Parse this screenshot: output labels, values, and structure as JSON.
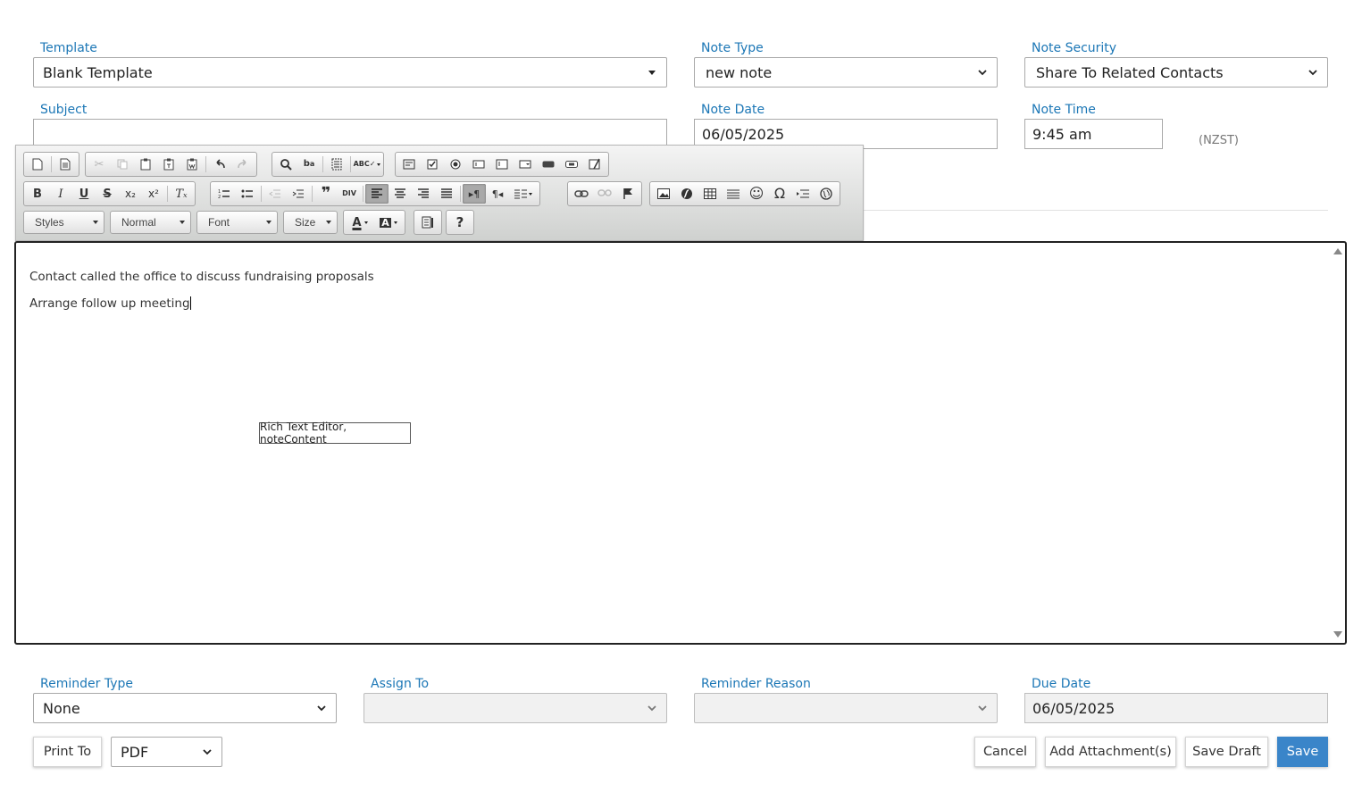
{
  "header_fields": {
    "template": {
      "label": "Template",
      "value": "Blank Template"
    },
    "note_type": {
      "label": "Note Type",
      "value": "new note"
    },
    "note_security": {
      "label": "Note Security",
      "value": "Share To Related Contacts"
    },
    "subject": {
      "label": "Subject",
      "value": ""
    },
    "note_date": {
      "label": "Note Date",
      "value": "06/05/2025"
    },
    "note_time": {
      "label": "Note Time",
      "value": "9:45 am",
      "timezone": "(NZST)"
    }
  },
  "toolbar": {
    "combos": {
      "styles": "Styles",
      "format": "Normal",
      "font": "Font",
      "size": "Size"
    },
    "row1_icons": [
      "new-page-icon",
      "templates-icon",
      "cut-icon",
      "copy-icon",
      "paste-icon",
      "paste-text-icon",
      "paste-word-icon",
      "undo-icon",
      "redo-icon",
      "find-icon",
      "replace-icon",
      "select-all-icon",
      "spellcheck-icon",
      "form-icon",
      "checkbox-icon",
      "radio-icon",
      "textfield-icon",
      "textarea-icon",
      "select-field-icon",
      "button-icon",
      "image-button-icon",
      "hidden-field-icon"
    ],
    "row2_icons": [
      "bold-icon",
      "italic-icon",
      "underline-icon",
      "strike-icon",
      "subscript-icon",
      "superscript-icon",
      "remove-format-icon",
      "numbered-list-icon",
      "bulleted-list-icon",
      "outdent-icon",
      "indent-icon",
      "blockquote-icon",
      "creatediv-icon",
      "align-left-icon",
      "align-center-icon",
      "align-right-icon",
      "align-justify-icon",
      "ltr-icon",
      "rtl-icon",
      "language-icon",
      "link-icon",
      "unlink-icon",
      "anchor-icon",
      "image-icon",
      "flash-icon",
      "table-icon",
      "horizontal-rule-icon",
      "smiley-icon",
      "special-char-icon",
      "page-break-icon",
      "iframe-icon"
    ],
    "glyphs": {
      "bold": "B",
      "italic": "I",
      "underline": "U",
      "strike": "S",
      "subscript": "x₂",
      "superscript": "x²",
      "remove_format": "Tₓ",
      "blockquote": "❞",
      "creatediv": "DIV",
      "ltr": "▸¶",
      "rtl": "¶◂",
      "smiley": "☺",
      "omega": "Ω",
      "help": "?",
      "text_color": "A",
      "bg_color": "A",
      "spell": "ABC"
    }
  },
  "editor": {
    "lines": [
      "Contact called the office to discuss fundraising proposals",
      "Arrange follow up meeting"
    ],
    "tooltip": "Rich Text Editor, noteContent"
  },
  "reminder": {
    "reminder_type": {
      "label": "Reminder Type",
      "value": "None"
    },
    "assign_to": {
      "label": "Assign To",
      "value": ""
    },
    "reminder_reason": {
      "label": "Reminder Reason",
      "value": ""
    },
    "due_date": {
      "label": "Due Date",
      "value": "06/05/2025"
    }
  },
  "actions": {
    "print_to": "Print To",
    "print_format": "PDF",
    "cancel": "Cancel",
    "add_attachment": "Add Attachment(s)",
    "save_draft": "Save Draft",
    "save": "Save"
  },
  "colors": {
    "label": "#1c77b6",
    "primary_button": "#3a85c9"
  }
}
